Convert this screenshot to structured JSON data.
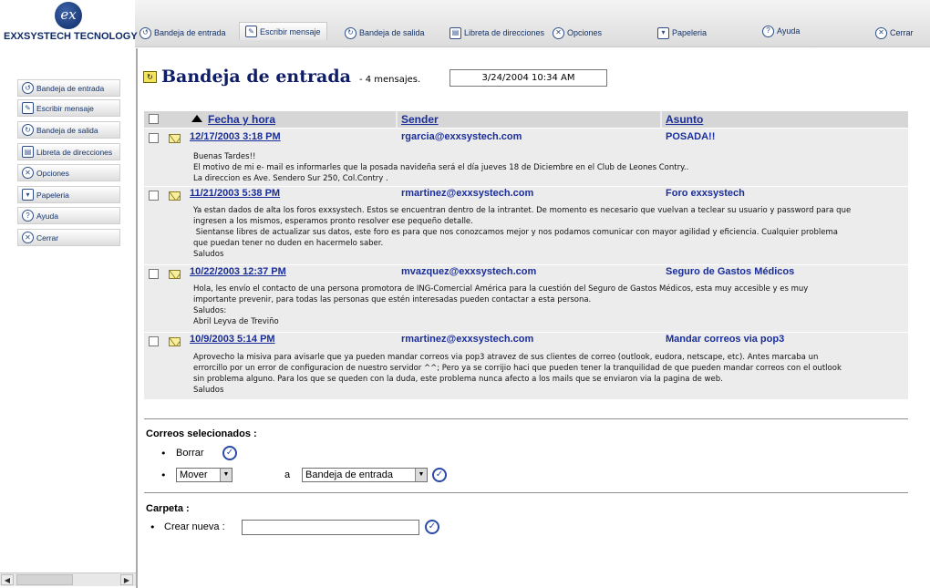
{
  "brand": {
    "name": "EXXSYSTECH TECNOLOGY",
    "mark": "ex"
  },
  "tabs": [
    {
      "label": "Bandeja de entrada",
      "icon": "inbox-icon"
    },
    {
      "label": "Escribir mensaje",
      "icon": "compose-icon",
      "active": true
    },
    {
      "label": "Bandeja de salida",
      "icon": "outbox-icon"
    },
    {
      "label": "Libreta de direcciones",
      "icon": "address-book-icon"
    },
    {
      "label": "Opciones",
      "icon": "options-icon"
    },
    {
      "label": "Papeleria",
      "icon": "trash-icon"
    },
    {
      "label": "Ayuda",
      "icon": "help-icon"
    },
    {
      "label": "Cerrar",
      "icon": "close-icon"
    }
  ],
  "sidebar": {
    "items": [
      {
        "label": "Bandeja de entrada",
        "icon": "inbox-icon"
      },
      {
        "label": "Escribir mensaje",
        "icon": "compose-icon"
      },
      {
        "label": "Bandeja de salida",
        "icon": "outbox-icon"
      },
      {
        "label": "Libreta de direcciones",
        "icon": "address-book-icon"
      },
      {
        "label": "Opciones",
        "icon": "options-icon"
      },
      {
        "label": "Papeleria",
        "icon": "trash-icon"
      },
      {
        "label": "Ayuda",
        "icon": "help-icon"
      },
      {
        "label": "Cerrar",
        "icon": "close-icon"
      }
    ]
  },
  "main": {
    "title": "Bandeja de entrada",
    "count": "- 4 mensajes.",
    "datetime": "3/24/2004 10:34 AM",
    "columns": {
      "date": "Fecha y hora",
      "sender": "Sender",
      "subject": "Asunto"
    },
    "messages": [
      {
        "date": " 12/17/2003 3:18 PM ",
        "sender": "rgarcia@exxsystech.com",
        "subject": "POSADA!!",
        "body": "Buenas Tardes!!\nEl motivo de mi e- mail es informarles que la posada navideña será el día jueves 18 de Diciembre en el Club de Leones Contry..\nLa direccion es Ave. Sendero Sur 250, Col.Contry ."
      },
      {
        "date": " 11/21/2003 5:38 PM ",
        "sender": "rmartinez@exxsystech.com",
        "subject": "Foro exxsystech",
        "body": "Ya estan dados de alta los foros exxsystech. Estos se encuentran dentro de la intrantet. De momento es necesario que vuelvan a teclear su usuario y password para que\ningresen a los mismos, esperamos pronto resolver ese pequeño detalle.\n Sientanse libres de actualizar sus datos, este foro es para que nos conozcamos mejor y nos podamos comunicar con mayor agilidad y eficiencia. Cualquier problema\nque puedan tener no duden en hacermelo saber.\nSaludos"
      },
      {
        "date": " 10/22/2003 12:37 PM ",
        "sender": "mvazquez@exxsystech.com",
        "subject": "Seguro de Gastos Médicos",
        "body": "Hola, les envío el contacto de una persona promotora de ING-Comercial América para la cuestión del Seguro de Gastos Médicos, esta muy accesible y es muy\nimportante prevenir, para todas las personas que estén interesadas pueden contactar a esta persona.\nSaludos:\nAbril Leyva de Treviño"
      },
      {
        "date": " 10/9/2003 5:14 PM ",
        "sender": "rmartinez@exxsystech.com",
        "subject": "Mandar correos via pop3",
        "body": "Aprovecho la misiva para avisarle que ya pueden mandar correos via pop3 atravez de sus clientes de correo (outlook, eudora, netscape, etc). Antes marcaba un\nerrorcillo por un error de configuracion de nuestro servidor ^^; Pero ya se corrijio haci que pueden tener la tranquilidad de que pueden mandar correos con el outlook\nsin problema alguno. Para los que se queden con la duda, este problema nunca afecto a los mails que se enviaron via la pagina de web.\nSaludos"
      }
    ]
  },
  "actions": {
    "selected_title": "Correos selecionados :",
    "delete_label": "Borrar",
    "move_value": "Mover",
    "to_label": "a",
    "folder_value": "Bandeja de entrada",
    "folder_title": "Carpeta :",
    "create_label": "Crear nueva :",
    "create_value": ""
  },
  "colors": {
    "link": "#1a2e9a",
    "title": "#0f1d66",
    "table_bg": "#ececec",
    "header_bg": "#d6d6d6"
  }
}
